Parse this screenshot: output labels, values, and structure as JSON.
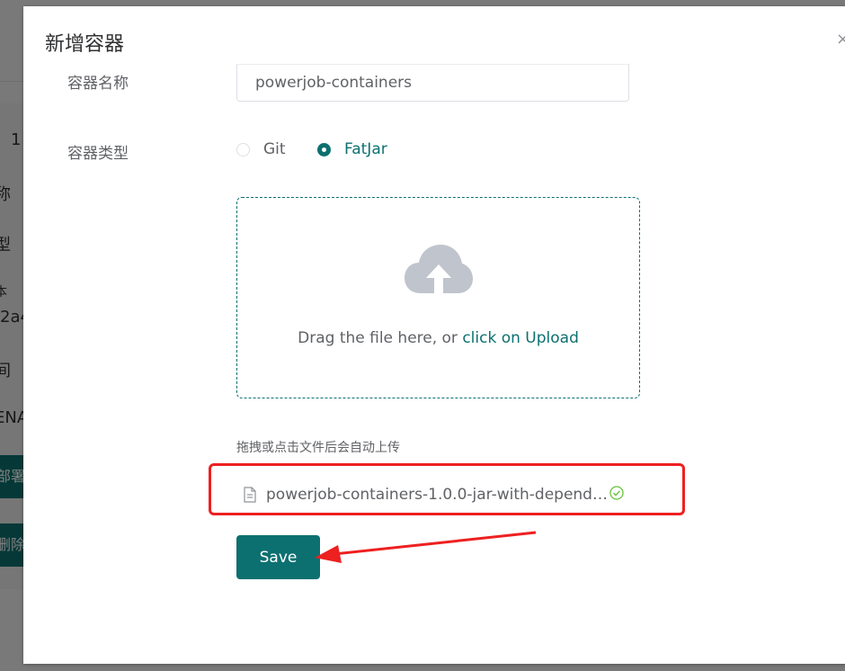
{
  "background": {
    "peek_texts": [
      "1",
      "称",
      "型",
      "本",
      "2a4",
      "间",
      "ENA"
    ],
    "peek_buttons": [
      "部署",
      "删除"
    ]
  },
  "dialog": {
    "title": "新增容器",
    "close_glyph": "×",
    "form": {
      "name_label": "容器名称",
      "name_value": "powerjob-containers",
      "type_label": "容器类型",
      "type_options": [
        {
          "label": "Git",
          "checked": false
        },
        {
          "label": "FatJar",
          "checked": true
        }
      ]
    },
    "upload": {
      "text_prefix": "Drag the file here, or ",
      "text_link": "click on Upload",
      "tip": "拖拽或点击文件后会自动上传",
      "icon": "cloud-upload-icon"
    },
    "file": {
      "name": "powerjob-containers-1.0.0-jar-with-depend…",
      "status_icon": "check-circle-icon",
      "doc_icon": "document-icon"
    },
    "save_label": "Save"
  },
  "colors": {
    "primary": "#0d7070",
    "highlight": "#ee2020",
    "success": "#67c23a"
  }
}
